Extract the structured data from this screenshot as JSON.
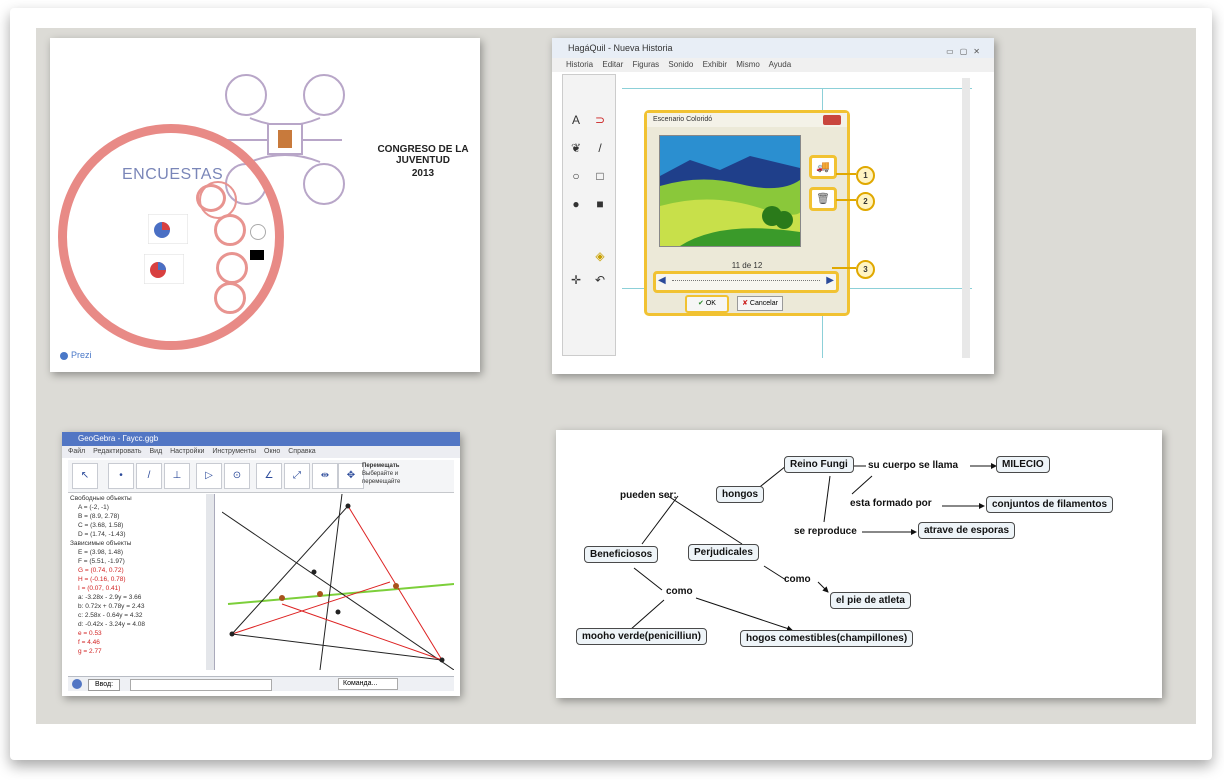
{
  "prezi": {
    "title": "ENCUESTAS",
    "subtitle": "CONGRESO DE LA JUVENTUD",
    "year": "2013",
    "logo": "Prezi"
  },
  "hagaquil": {
    "window_title": "HagáQuil - Nueva Historia",
    "menu": [
      "Historia",
      "Editar",
      "Figuras",
      "Sonido",
      "Exhibir",
      "Mismo",
      "Ayuda"
    ],
    "dialog_title": "Escenario Coloridó",
    "counter": "11 de 12",
    "ok_label": "OK",
    "cancel_label": "Cancelar",
    "callouts": [
      "1",
      "2",
      "3"
    ],
    "tool_labels": {
      "text": "A"
    }
  },
  "geogebra": {
    "window_title": "GeoGebra - Гаусс.ggb",
    "menu": [
      "Файл",
      "Редактировать",
      "Вид",
      "Настройки",
      "Инструменты",
      "Окно",
      "Справка"
    ],
    "tool_hint": [
      "Перемещать",
      "Выберайте и",
      "перемещайте"
    ],
    "free_objects_label": "Свободные объекты",
    "free_objects": [
      "A = (-2, -1)",
      "B = (8.9, 2.78)",
      "C = (3.68, 1.58)",
      "D = (1.74, -1.43)"
    ],
    "dependent_objects_label": "Зависимые объекты",
    "dependent_objects": [
      {
        "text": "E = (3.98, 1.48)",
        "color": "#333333"
      },
      {
        "text": "F = (5.51, -1.97)",
        "color": "#333333"
      },
      {
        "text": "G = (0.74, 0.72)",
        "color": "#d22222"
      },
      {
        "text": "H = (-0.16, 0.78)",
        "color": "#d22222"
      },
      {
        "text": "I = (0.07, 0.41)",
        "color": "#d22222"
      },
      {
        "text": "a: -3.28x - 2.9y = 3.66",
        "color": "#333333"
      },
      {
        "text": "b: 0.72x + 0.78y = 2.43",
        "color": "#333333"
      },
      {
        "text": "c: 2.58x - 0.64y = 4.32",
        "color": "#333333"
      },
      {
        "text": "d: -0.42x - 3.24y = 4.08",
        "color": "#333333"
      },
      {
        "text": "e = 0.53",
        "color": "#d22222"
      },
      {
        "text": "f = 4.46",
        "color": "#d22222"
      },
      {
        "text": "g = 2.77",
        "color": "#d22222"
      }
    ],
    "input_label": "Ввод:",
    "command_label": "Команда..."
  },
  "concept_map": {
    "nodes": {
      "reino": "Reino Fungi",
      "milecio": "MILECIO",
      "hongos": "hongos",
      "conjuntos": "conjuntos de filamentos",
      "esporas": "atrave de esporas",
      "beneficiosos": "Beneficiosos",
      "perjudicales": "Perjudicales",
      "pie": "el pie de atleta",
      "moho": "mooho verde(penicilliun)",
      "comestibles": "hogos comestibles(champillones)"
    },
    "labels": {
      "cuerpo": "su cuerpo se llama",
      "pueden": "pueden ser:",
      "formado": "esta formado por",
      "reproduce": "se reproduce",
      "como1": "como",
      "como2": "como"
    }
  },
  "colors": {
    "prezi_circle": "#e88a86",
    "highlight": "#f1c232",
    "geogebra_title": "#5276c4",
    "mat": "#dcdbd6"
  }
}
